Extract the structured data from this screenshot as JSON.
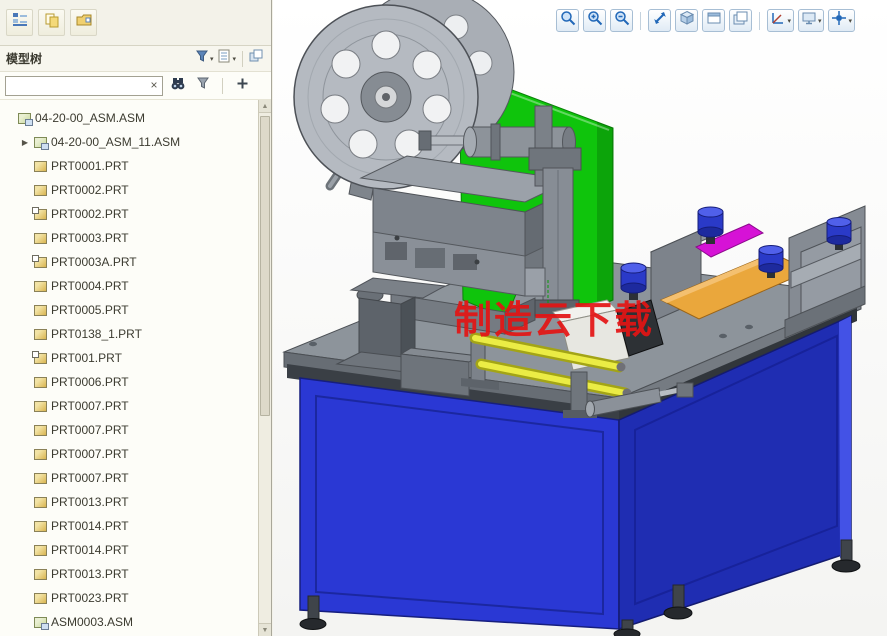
{
  "colors": {
    "canvas_bg": "#ffffff",
    "panel_bg": "#f3f2e9",
    "machine_green": "#0fc40c",
    "cabinet_blue_front": "#2a38d4",
    "cabinet_blue_side": "#1f2db2",
    "accent_orange": "#eaa73c",
    "accent_magenta": "#d612d6",
    "accent_yellow": "#ebec45",
    "knob_blue": "#2a3ac8",
    "watermark_red": "#e41414"
  },
  "navigator_toolbar": {
    "icons": [
      "model-tree-toggle-icon",
      "refresh-tree-icon",
      "open-folder-icon"
    ]
  },
  "graphics_toolbar": {
    "buttons": [
      "zoom-window",
      "zoom-in",
      "zoom-out",
      "refit",
      "display-style",
      "named-views",
      "view-manager",
      "datum-display",
      "saved-orientations",
      "spin-center"
    ]
  },
  "tree_panel": {
    "title": "模型树",
    "header_icons": [
      "tree-filters-icon",
      "tree-columns-icon",
      "panel-options-icon"
    ],
    "search": {
      "value": "",
      "clear": "×"
    },
    "search_tools": [
      "find-icon",
      "filter-icon",
      "add-icon"
    ],
    "items": [
      {
        "label": "04-20-00_ASM.ASM",
        "type": "asm",
        "level": 0,
        "arrow": false
      },
      {
        "label": "04-20-00_ASM_11.ASM",
        "type": "asm",
        "level": 1,
        "arrow": true
      },
      {
        "label": "PRT0001.PRT",
        "type": "prt",
        "level": 1
      },
      {
        "label": "PRT0002.PRT",
        "type": "prt",
        "level": 1
      },
      {
        "label": "PRT0002.PRT",
        "type": "prt",
        "level": 1,
        "badge": true
      },
      {
        "label": "PRT0003.PRT",
        "type": "prt",
        "level": 1
      },
      {
        "label": "PRT0003A.PRT",
        "type": "prt",
        "level": 1,
        "badge": true
      },
      {
        "label": "PRT0004.PRT",
        "type": "prt",
        "level": 1
      },
      {
        "label": "PRT0005.PRT",
        "type": "prt",
        "level": 1
      },
      {
        "label": "PRT0138_1.PRT",
        "type": "prt",
        "level": 1
      },
      {
        "label": "PRT001.PRT",
        "type": "prt",
        "level": 1,
        "badge": true
      },
      {
        "label": "PRT0006.PRT",
        "type": "prt",
        "level": 1
      },
      {
        "label": "PRT0007.PRT",
        "type": "prt",
        "level": 1
      },
      {
        "label": "PRT0007.PRT",
        "type": "prt",
        "level": 1
      },
      {
        "label": "PRT0007.PRT",
        "type": "prt",
        "level": 1
      },
      {
        "label": "PRT0007.PRT",
        "type": "prt",
        "level": 1
      },
      {
        "label": "PRT0013.PRT",
        "type": "prt",
        "level": 1
      },
      {
        "label": "PRT0014.PRT",
        "type": "prt",
        "level": 1
      },
      {
        "label": "PRT0014.PRT",
        "type": "prt",
        "level": 1
      },
      {
        "label": "PRT0013.PRT",
        "type": "prt",
        "level": 1
      },
      {
        "label": "PRT0023.PRT",
        "type": "prt",
        "level": 1
      },
      {
        "label": "ASM0003.ASM",
        "type": "asm",
        "level": 1
      }
    ]
  },
  "canvas": {
    "watermark": "制造云下载"
  }
}
